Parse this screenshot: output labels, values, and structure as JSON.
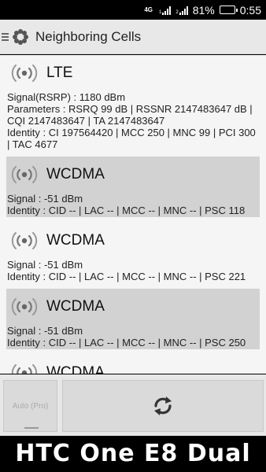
{
  "status_bar": {
    "network": "4G",
    "sim1_label": "1",
    "sim2_label": "2",
    "battery": "81%",
    "battery_level": 0.81,
    "time": "0:55"
  },
  "action_bar": {
    "title": "Neighboring Cells",
    "app_icon": "flower-gear-icon",
    "menu_icon": "menu-icon"
  },
  "cells": [
    {
      "type": "LTE",
      "lines": [
        "Signal(RSRP) : 1180 dBm",
        "Parameters : RSRQ 99 dB | RSSNR 2147483647 dB | CQI 2147483647 | TA 2147483647",
        "Identity : CI 197564420 | MCC 250 | MNC 99 | PCI 300 | TAC 4677"
      ]
    },
    {
      "type": "WCDMA",
      "lines": [
        "Signal : -51 dBm",
        "Identity : CID -- | LAC -- | MCC -- | MNC -- | PSC 118"
      ]
    },
    {
      "type": "WCDMA",
      "lines": [
        "Signal : -51 dBm",
        "Identity : CID -- | LAC -- | MCC -- | MNC -- | PSC 221"
      ]
    },
    {
      "type": "WCDMA",
      "lines": [
        "Signal : -51 dBm",
        "Identity : CID -- | LAC -- | MCC -- | MNC -- | PSC 250"
      ]
    },
    {
      "type": "WCDMA",
      "lines": []
    }
  ],
  "bottom_bar": {
    "auto_button_label": "Auto (Pro)",
    "refresh_icon": "refresh-icon"
  },
  "device_label": "HTC One E8 Dual"
}
